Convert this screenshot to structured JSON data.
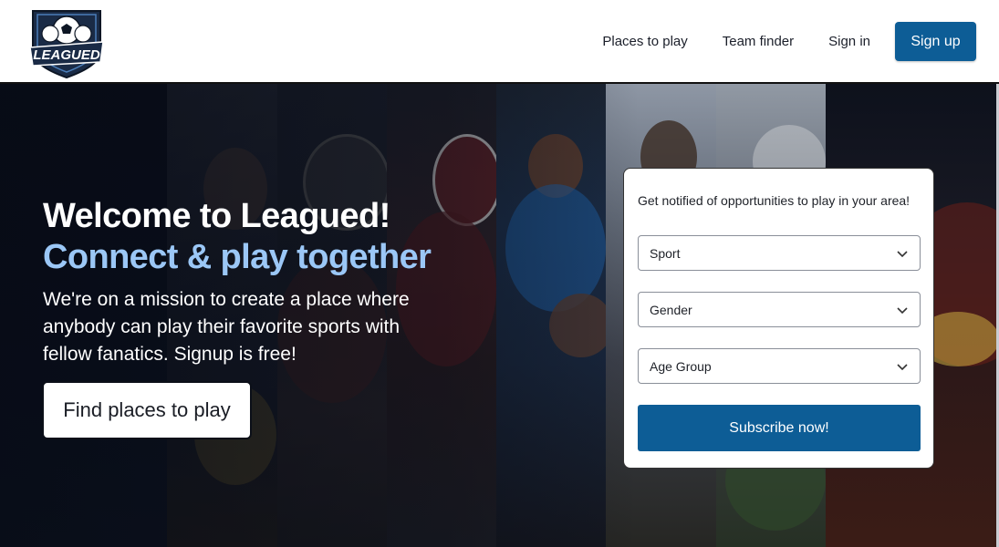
{
  "brand": {
    "logo_text": "LEAGUED"
  },
  "nav": {
    "items": [
      "Places to play",
      "Team finder",
      "Sign in"
    ],
    "signup_label": "Sign up"
  },
  "hero": {
    "title": "Welcome to Leagued!",
    "subtitle": "Connect & play together",
    "description": "We're on a mission to create a place where anybody can play their favorite sports with fellow fanatics. Signup is free!",
    "cta_label": "Find places to play"
  },
  "subscribe": {
    "title": "Get notified of opportunities to play in your area!",
    "selects": [
      {
        "value": "Sport"
      },
      {
        "value": "Gender"
      },
      {
        "value": "Age Group"
      }
    ],
    "button_label": "Subscribe now!"
  },
  "colors": {
    "accent": "#0d5d96",
    "subtitle": "#9bc7f6"
  }
}
